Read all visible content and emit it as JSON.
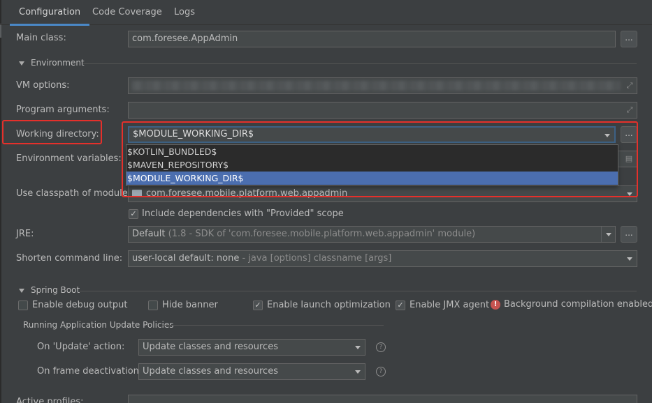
{
  "tabs": [
    {
      "label": "Configuration"
    },
    {
      "label": "Code Coverage"
    },
    {
      "label": "Logs"
    }
  ],
  "main_class": {
    "label": "Main class:",
    "value": "com.foresee.AppAdmin",
    "browse": "..."
  },
  "environment": {
    "section_label": "Environment"
  },
  "vm_options": {
    "label": "VM options:"
  },
  "program_arguments": {
    "label": "Program arguments:"
  },
  "working_directory": {
    "label": "Working directory:",
    "value": "$MODULE_WORKING_DIR$",
    "browse": "...",
    "dropdown_items": [
      "$KOTLIN_BUNDLED$",
      "$MAVEN_REPOSITORY$",
      "$MODULE_WORKING_DIR$"
    ]
  },
  "environment_variables": {
    "label": "Environment variables:"
  },
  "classpath_module": {
    "label": "Use classpath of module:",
    "value": "com.foresee.mobile.platform.web.appadmin"
  },
  "include_dependencies": {
    "label": "Include dependencies with \"Provided\" scope",
    "checked": true
  },
  "jre": {
    "label": "JRE:",
    "value": "Default",
    "detail": " (1.8 - SDK of 'com.foresee.mobile.platform.web.appadmin' module)",
    "browse": "..."
  },
  "shorten_command": {
    "label": "Shorten command line:",
    "value": "user-local default: none",
    "detail": " - java [options] classname [args]"
  },
  "spring_boot": {
    "section_label": "Spring Boot",
    "options": [
      {
        "label": "Enable debug output",
        "checked": false
      },
      {
        "label": "Hide banner",
        "checked": false
      },
      {
        "label": "Enable launch optimization",
        "checked": true
      },
      {
        "label": "Enable JMX agent",
        "checked": true
      }
    ],
    "warning": "Background compilation enabled"
  },
  "update_policies": {
    "section_label": "Running Application Update Policies",
    "on_update": {
      "label": "On 'Update' action:",
      "value": "Update classes and resources"
    },
    "on_frame_deactivation": {
      "label": "On frame deactivation:",
      "value": "Update classes and resources"
    }
  },
  "active_profiles": {
    "label": "Active profiles:"
  },
  "colors": {
    "accent": "#4a88c7",
    "selection": "#4b6eaf",
    "highlight_box": "#e5302b",
    "warning": "#c75450"
  }
}
